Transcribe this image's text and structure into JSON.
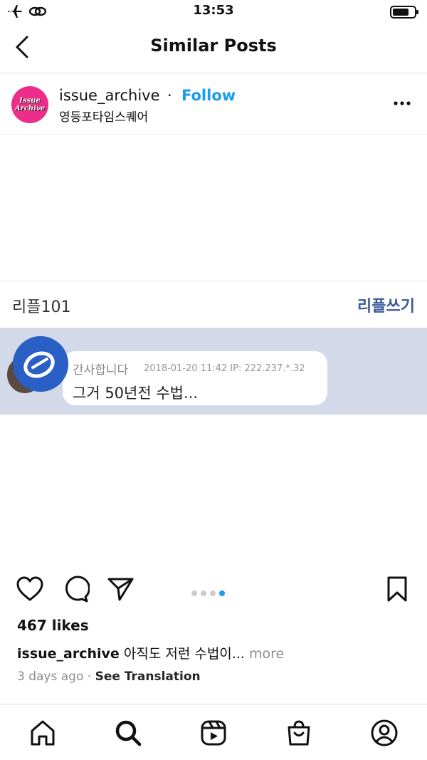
{
  "status_bar": {
    "time": "13:53",
    "icons": [
      "airplane-icon",
      "link-icon",
      "battery-icon"
    ]
  },
  "header": {
    "title": "Similar Posts",
    "back_icon": "chevron-left-icon"
  },
  "post": {
    "avatar_text": [
      "Issue",
      "Archive"
    ],
    "avatar_color": "#ee2d8a",
    "username": "issue_archive",
    "separator": "·",
    "follow_label": "Follow",
    "follow_color": "#1a9cf0",
    "location": "영등포타임스퀘어",
    "image": {
      "reply_count": "리플101",
      "reply_write": "리플쓰기",
      "reply_author": "간사합니다",
      "reply_meta": "2018-01-20 11:42  IP: 222.237.*.32",
      "reply_text": "그거 50년전 수법...",
      "band_color": "#d4d9ea"
    },
    "carousel": {
      "count": 4,
      "active_index": 3
    },
    "likes": "467 likes",
    "caption_user": "issue_archive",
    "caption_text": "아직도 저런 수법이...",
    "caption_more": "more",
    "time_ago": "3 days ago",
    "see_translation": "See Translation"
  },
  "tab_bar": [
    "home-icon",
    "search-icon",
    "reels-icon",
    "shop-icon",
    "profile-icon"
  ]
}
